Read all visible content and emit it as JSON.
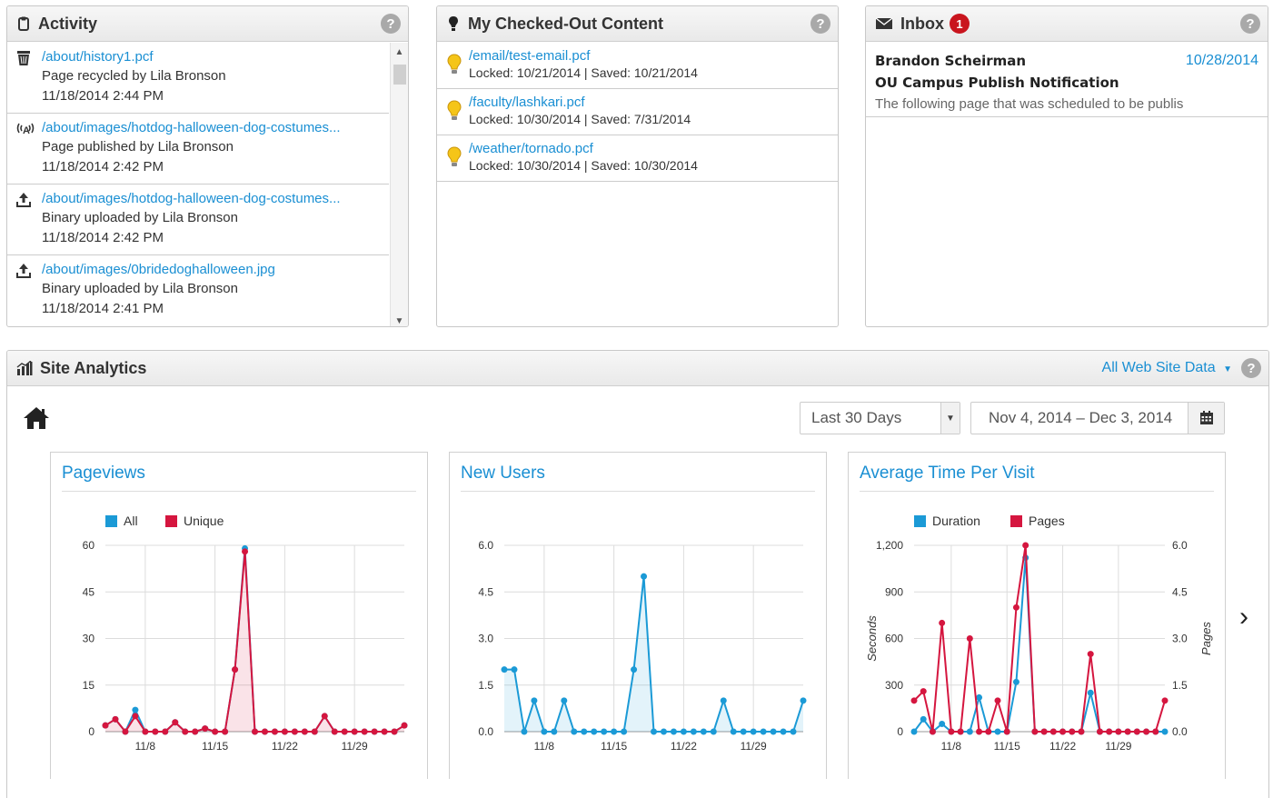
{
  "activity": {
    "title": "Activity",
    "items": [
      {
        "icon": "trash-icon",
        "path": "/about/history1.pcf",
        "action": "Page recycled by Lila Bronson",
        "time": "11/18/2014 2:44 PM"
      },
      {
        "icon": "broadcast-icon",
        "path": "/about/images/hotdog-halloween-dog-costumes...",
        "action": "Page published by Lila Bronson",
        "time": "11/18/2014 2:42 PM"
      },
      {
        "icon": "upload-icon",
        "path": "/about/images/hotdog-halloween-dog-costumes...",
        "action": "Binary uploaded by Lila Bronson",
        "time": "11/18/2014 2:42 PM"
      },
      {
        "icon": "upload-icon",
        "path": "/about/images/0bridedoghalloween.jpg",
        "action": "Binary uploaded by Lila Bronson",
        "time": "11/18/2014 2:41 PM"
      }
    ]
  },
  "checked_out": {
    "title": "My Checked-Out Content",
    "items": [
      {
        "path": "/email/test-email.pcf",
        "meta": "Locked: 10/21/2014 | Saved: 10/21/2014"
      },
      {
        "path": "/faculty/lashkari.pcf",
        "meta": "Locked: 10/30/2014 | Saved: 7/31/2014"
      },
      {
        "path": "/weather/tornado.pcf",
        "meta": "Locked: 10/30/2014 | Saved: 10/30/2014"
      }
    ]
  },
  "inbox": {
    "title": "Inbox",
    "unread": "1",
    "messages": [
      {
        "from": "Brandon Scheirman",
        "date": "10/28/2014",
        "subject": "OU Campus Publish Notification",
        "preview": "The following page that was scheduled to be publis"
      }
    ]
  },
  "analytics": {
    "title": "Site Analytics",
    "scope": "All Web Site Data",
    "range_select": "Last 30 Days",
    "date_range": "Nov 4, 2014 – Dec 3, 2014",
    "next_arrow": "›"
  },
  "colors": {
    "blue": "#1b9ad6",
    "red": "#d5163f",
    "link": "#1a8fd3"
  },
  "chart_data": [
    {
      "type": "line",
      "title": "Pageviews",
      "x_tick_labels": [
        "11/8",
        "11/15",
        "11/22",
        "11/29"
      ],
      "x_tick_index": [
        4,
        11,
        18,
        25
      ],
      "ylim": [
        0,
        60
      ],
      "y_ticks": [
        0,
        15,
        30,
        45,
        60
      ],
      "legend_position": "top",
      "series": [
        {
          "name": "All",
          "color": "#1b9ad6",
          "values": [
            2,
            4,
            0,
            7,
            0,
            0,
            0,
            3,
            0,
            0,
            1,
            0,
            0,
            20,
            59,
            0,
            0,
            0,
            0,
            0,
            0,
            0,
            5,
            0,
            0,
            0,
            0,
            0,
            0,
            0,
            2
          ]
        },
        {
          "name": "Unique",
          "color": "#d5163f",
          "area": true,
          "values": [
            2,
            4,
            0,
            5,
            0,
            0,
            0,
            3,
            0,
            0,
            1,
            0,
            0,
            20,
            58,
            0,
            0,
            0,
            0,
            0,
            0,
            0,
            5,
            0,
            0,
            0,
            0,
            0,
            0,
            0,
            2
          ]
        }
      ]
    },
    {
      "type": "area",
      "title": "New Users",
      "x_tick_labels": [
        "11/8",
        "11/15",
        "11/22",
        "11/29"
      ],
      "x_tick_index": [
        4,
        11,
        18,
        25
      ],
      "ylim": [
        0,
        6
      ],
      "y_ticks": [
        "0.0",
        "1.5",
        "3.0",
        "4.5",
        "6.0"
      ],
      "series": [
        {
          "name": "",
          "color": "#1b9ad6",
          "values": [
            2,
            2,
            0,
            1,
            0,
            0,
            1,
            0,
            0,
            0,
            0,
            0,
            0,
            2,
            5,
            0,
            0,
            0,
            0,
            0,
            0,
            0,
            1,
            0,
            0,
            0,
            0,
            0,
            0,
            0,
            1
          ]
        }
      ]
    },
    {
      "type": "line",
      "title": "Average Time Per Visit",
      "x_tick_labels": [
        "11/8",
        "11/15",
        "11/22",
        "11/29"
      ],
      "x_tick_index": [
        4,
        10,
        16,
        22
      ],
      "ylim": [
        0,
        1200
      ],
      "y_ticks": [
        "0",
        "300",
        "600",
        "900",
        "1,200"
      ],
      "ylabel": "Seconds",
      "ylim_right": [
        0,
        6
      ],
      "y_ticks_right": [
        "0.0",
        "1.5",
        "3.0",
        "4.5",
        "6.0"
      ],
      "ylabel_right": "Pages",
      "legend_position": "top",
      "series": [
        {
          "name": "Duration",
          "color": "#1b9ad6",
          "axis": "left",
          "values": [
            0,
            80,
            0,
            50,
            0,
            0,
            0,
            220,
            0,
            0,
            0,
            320,
            1120,
            0,
            0,
            0,
            0,
            0,
            0,
            250,
            0,
            0,
            0,
            0,
            0,
            0,
            0,
            0
          ]
        },
        {
          "name": "Pages",
          "color": "#d5163f",
          "axis": "right",
          "values": [
            1,
            1.3,
            0,
            3.5,
            0,
            0,
            3,
            0,
            0,
            1,
            0,
            4,
            6,
            0,
            0,
            0,
            0,
            0,
            0,
            2.5,
            0,
            0,
            0,
            0,
            0,
            0,
            0,
            1
          ]
        }
      ]
    }
  ]
}
